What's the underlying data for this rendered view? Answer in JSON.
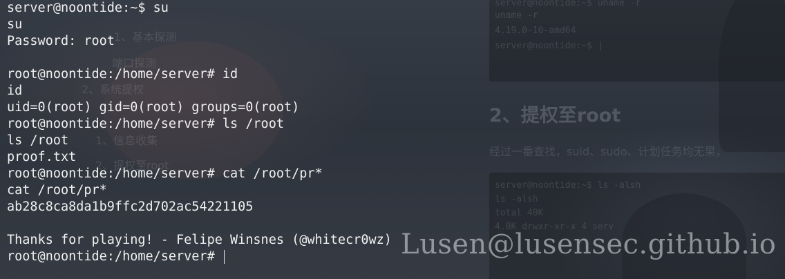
{
  "terminal": {
    "lines": [
      "server@noontide:~$ su",
      "su",
      "Password: root",
      "",
      "root@noontide:/home/server# id",
      "id",
      "uid=0(root) gid=0(root) groups=0(root)",
      "root@noontide:/home/server# ls /root",
      "ls /root",
      "proof.txt",
      "root@noontide:/home/server# cat /root/pr*",
      "cat /root/pr*",
      "ab28c8ca8da1b9ffc2d702ac54221105",
      "",
      "Thanks for playing! - Felipe Winsnes (@whitecr0wz)"
    ],
    "current_prompt": "root@noontide:/home/server#"
  },
  "background": {
    "code_block_1": [
      "server@noontide:~$ uname -r",
      "uname -r",
      "4.19.0-10-amd64",
      "server@noontide:~$ |"
    ],
    "heading": "2、提权至root",
    "paragraph": "经过一番查找，suid、sudo、计划任务均无果，",
    "code_block_2": [
      "server@noontide:~$ ls -alsh",
      "ls -alsh",
      "total 40K",
      "4.0K drwxr-xr-x 4 serv"
    ],
    "toc_items": [
      "1、基本探测",
      "端口探测",
      "2、系统提权",
      "1、信息收集",
      "2、提权至root"
    ]
  },
  "watermark": "Lusen@lusensec.github.io",
  "colors": {
    "text": "#f1f1f1",
    "background": "#2f353e"
  }
}
